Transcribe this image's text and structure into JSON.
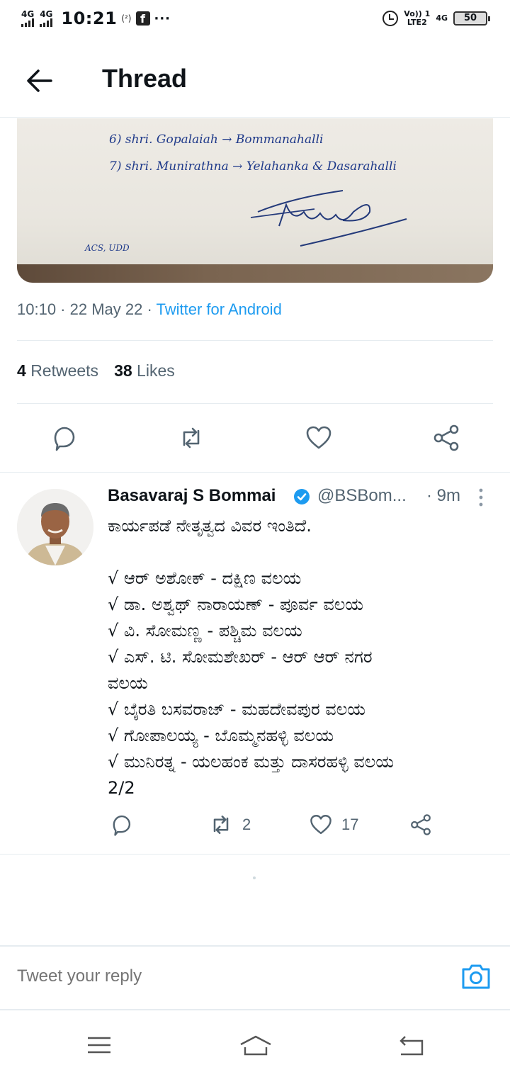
{
  "status_bar": {
    "sim1_network": "4G",
    "sim2_network": "4G",
    "time": "10:21",
    "hotspot_label": "(²)",
    "notification_app": "f",
    "more": "···",
    "volte_top": "Vo)) 1",
    "volte_bottom": "LTE2",
    "network_right": "4G",
    "battery": "50"
  },
  "header": {
    "title": "Thread"
  },
  "attached_image": {
    "line6": "6)   shri. Gopalaiah  →  Bommanahalli",
    "line7": "7)   shri. Munirathna  →  Yelahanka & Dasarahalli",
    "signature_note": "ACS, UDD"
  },
  "tweet_meta": {
    "time_date": "10:10 · 22 May 22 · ",
    "via": "Twitter for Android"
  },
  "stats": {
    "retweets_count": "4",
    "retweets_label": "Retweets",
    "likes_count": "38",
    "likes_label": "Likes"
  },
  "reply": {
    "name": "Basavaraj S Bommai",
    "handle": "@BSBom...",
    "time": "· 9m",
    "lines": [
      "ಕಾರ್ಯಪಡೆ ನೇತೃತ್ವದ ವಿವರ ಇಂತಿದೆ.",
      "",
      "√ ಆರ್ ಅಶೋಕ್ - ದಕ್ಷಿಣ ವಲಯ",
      "√ ಡಾ. ಅಶ್ವಥ್ ನಾರಾಯಣ್ - ಪೂರ್ವ ವಲಯ",
      "√ ವಿ. ಸೋಮಣ್ಣ - ಪಶ್ಚಿಮ ವಲಯ",
      "√ ಎಸ್. ಟಿ. ಸೋಮಶೇಖರ್ - ಆರ್ ಆರ್ ನಗರ",
      "ವಲಯ",
      "√ ಬೈರತಿ ಬಸವರಾಜ್ - ಮಹದೇವಪುರ ವಲಯ",
      "√ ಗೋಪಾಲಯ್ಯ - ಬೊಮ್ಮನಹಳ್ಳಿ ವಲಯ",
      "√ ಮುನಿರತ್ನ - ಯಲಹಂಕ ಮತ್ತು ದಾಸರಹಳ್ಳಿ ವಲಯ",
      "2/2"
    ],
    "retweet_count": "2",
    "like_count": "17"
  },
  "composer": {
    "placeholder": "Tweet your reply"
  },
  "colors": {
    "accent": "#1d9bf0",
    "text_primary": "#0f1419",
    "text_secondary": "#536471",
    "divider": "#e6ecf0"
  },
  "icons": {
    "back": "arrow-left-icon",
    "reply": "comment-icon",
    "retweet": "retweet-icon",
    "like": "heart-icon",
    "share": "share-icon",
    "verified": "verified-badge-icon",
    "camera": "camera-icon",
    "menu": "menu-icon",
    "home": "home-icon",
    "back_nav": "back-icon"
  }
}
